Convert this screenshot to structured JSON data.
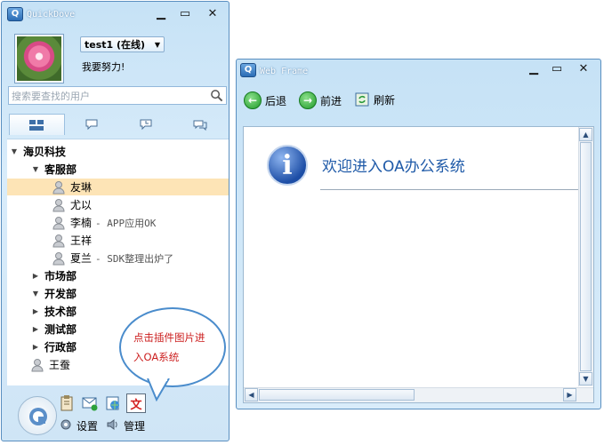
{
  "qd": {
    "title": "QuickDove",
    "status": "test1 (在线)",
    "signature": "我要努力!",
    "search_placeholder": "搜索要查找的用户",
    "tabs": [
      "contacts-icon",
      "chat-icon",
      "history-icon",
      "messages-icon"
    ],
    "tree": [
      {
        "label": "海贝科技",
        "type": "group",
        "level": 0,
        "expanded": true
      },
      {
        "label": "客服部",
        "type": "group",
        "level": 1,
        "expanded": true
      },
      {
        "label": "友琳",
        "type": "user",
        "level": 2,
        "selected": true
      },
      {
        "label": "尤以",
        "type": "user",
        "level": 2
      },
      {
        "label": "李楠",
        "type": "user",
        "level": 2,
        "note": "- APP应用OK"
      },
      {
        "label": "王祥",
        "type": "user",
        "level": 2
      },
      {
        "label": "夏兰",
        "type": "user",
        "level": 2,
        "note": "- SDK整理出炉了"
      },
      {
        "label": "市场部",
        "type": "group",
        "level": 1,
        "expanded": false
      },
      {
        "label": "开发部",
        "type": "group",
        "level": 1,
        "expanded": true
      },
      {
        "label": "技术部",
        "type": "group",
        "level": 1,
        "expanded": false
      },
      {
        "label": "测试部",
        "type": "group",
        "level": 1,
        "expanded": false
      },
      {
        "label": "行政部",
        "type": "group",
        "level": 1,
        "expanded": false
      },
      {
        "label": "王蚕",
        "type": "user",
        "level": 1
      }
    ],
    "callout": "点击插件图片进入OA系统",
    "settings_label": "设置",
    "manage_label": "管理"
  },
  "wf": {
    "title": "Web Frame",
    "back_label": "后退",
    "forward_label": "前进",
    "refresh_label": "刷新",
    "welcome": "欢迎进入OA办公系统"
  },
  "colors": {
    "accent": "#1f5aa8",
    "callout_text": "#cc1f1f",
    "selection": "#fde4b6"
  }
}
